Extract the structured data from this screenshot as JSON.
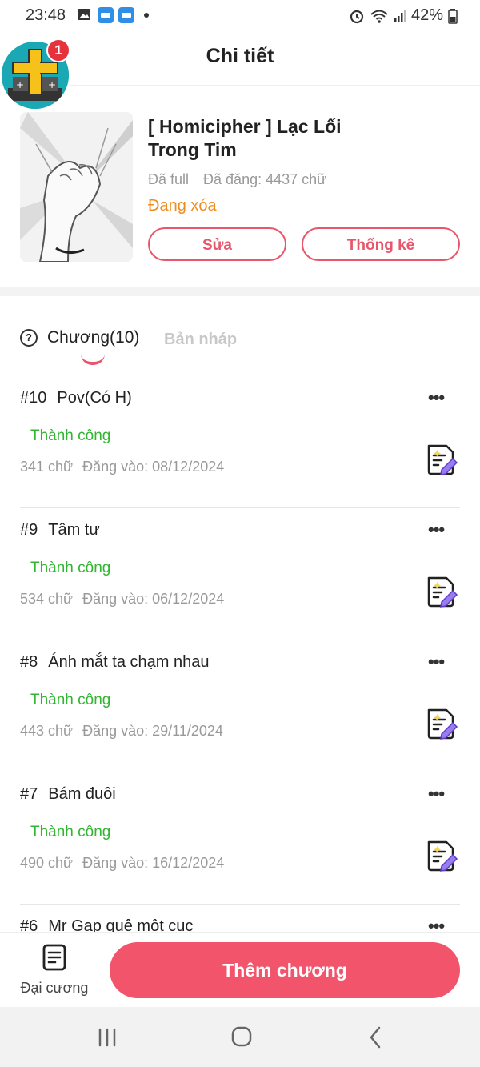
{
  "status_bar": {
    "time": "23:48",
    "battery": "42%",
    "icons": [
      "image-icon",
      "noveltoon-icon",
      "noveltoon-icon",
      "dot-icon",
      "alarm-icon",
      "wifi-icon",
      "signal-icon",
      "battery-icon"
    ]
  },
  "header": {
    "title": "Chi tiết"
  },
  "avatar": {
    "badge_count": "1"
  },
  "book": {
    "title": "[ Homicipher ] Lạc Lối Trong Tim",
    "status": "Đã full",
    "word_count": "Đã đăng: 4437 chữ",
    "state": "Đang xóa",
    "edit_label": "Sửa",
    "stats_label": "Thống kê"
  },
  "tabs": {
    "chapters_label": "Chương(10)",
    "drafts_label": "Bản nháp"
  },
  "chapters": [
    {
      "number": "#10",
      "title": "Pov(Có H)",
      "status": "Thành công",
      "words": "341 chữ",
      "published": "Đăng vào:  08/12/2024"
    },
    {
      "number": "#9",
      "title": "Tâm tư",
      "status": "Thành công",
      "words": "534 chữ",
      "published": "Đăng vào:  06/12/2024"
    },
    {
      "number": "#8",
      "title": "Ánh mắt ta chạm nhau",
      "status": "Thành công",
      "words": "443 chữ",
      "published": "Đăng vào:  29/11/2024"
    },
    {
      "number": "#7",
      "title": "Bám đuôi",
      "status": "Thành công",
      "words": "490 chữ",
      "published": "Đăng vào:  16/12/2024"
    },
    {
      "number": "#6",
      "title": "Mr Gap quê một cục",
      "status": "",
      "words": "",
      "published": ""
    }
  ],
  "bottom": {
    "outline_label": "Đại cương",
    "add_chapter_label": "Thêm chương"
  },
  "colors": {
    "accent": "#f2546c",
    "success": "#33b533",
    "warning": "#f08c1e"
  }
}
